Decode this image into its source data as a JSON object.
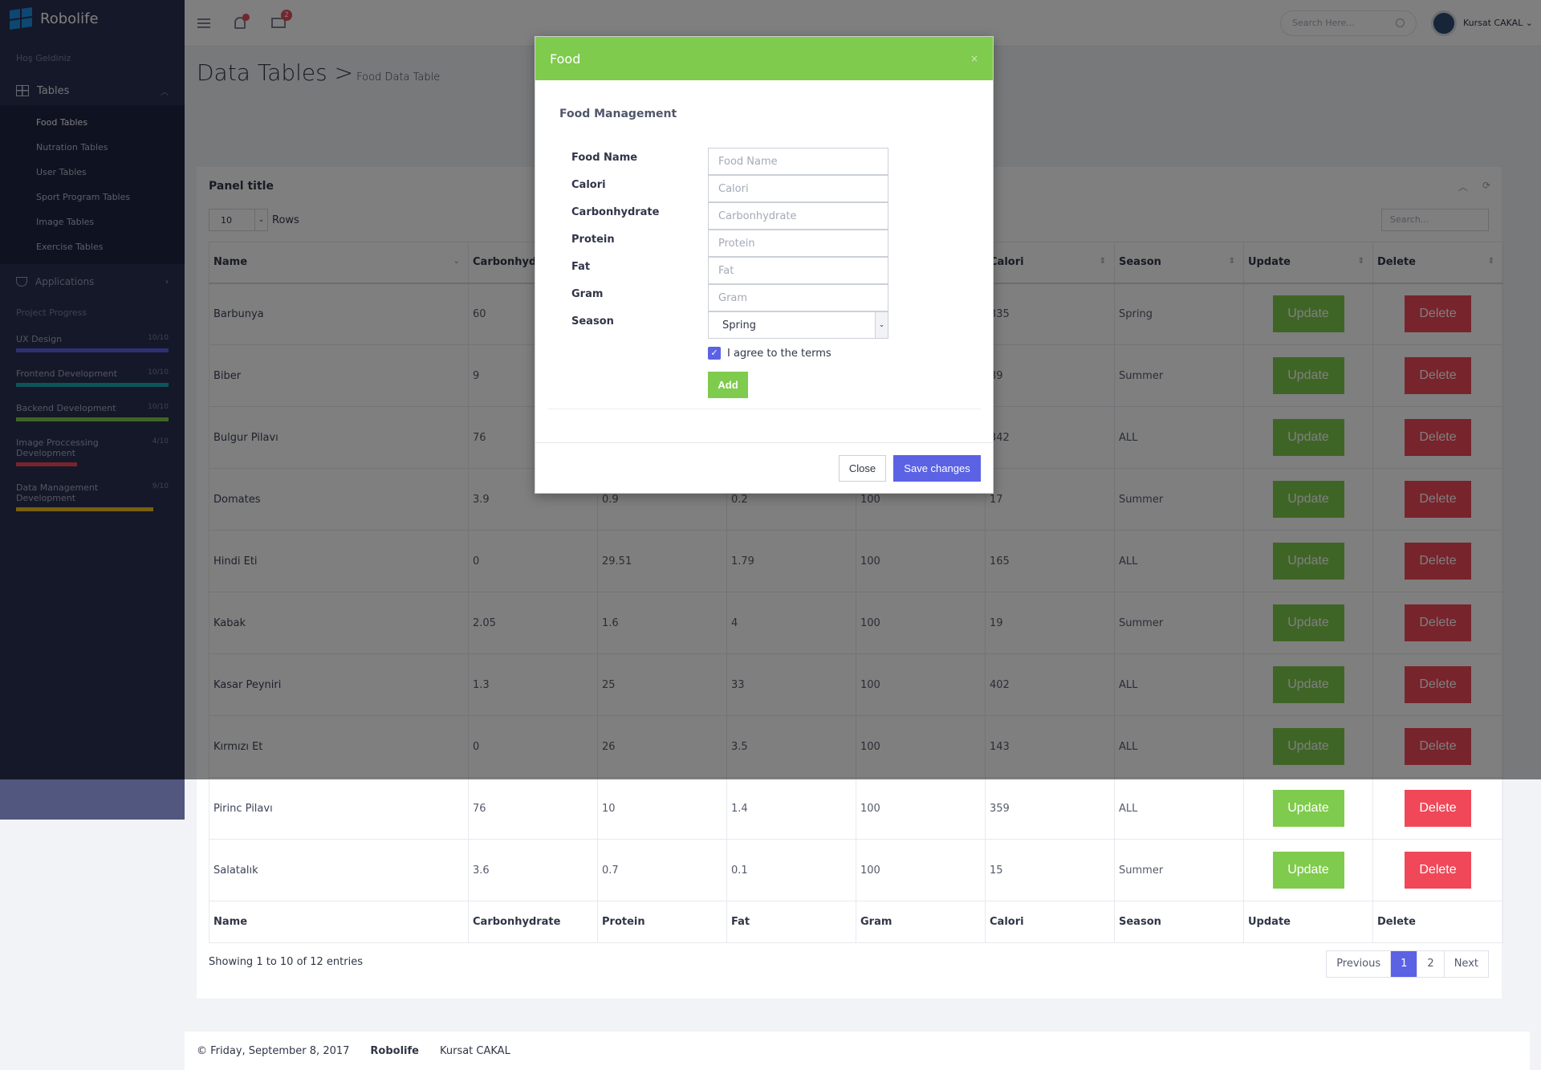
{
  "app": {
    "brand": "Robolife",
    "welcome": "Hoş Geldiniz"
  },
  "sidebar": {
    "tables_label": "Tables",
    "items": [
      {
        "label": "Food Tables"
      },
      {
        "label": "Nutration Tables"
      },
      {
        "label": "User Tables"
      },
      {
        "label": "Sport Program Tables"
      },
      {
        "label": "Image Tables"
      },
      {
        "label": "Exercise Tables"
      }
    ],
    "applications_label": "Applications",
    "progress_title": "Project Progress",
    "progress": [
      {
        "name": "UX Design",
        "value": "10/10",
        "fraction": 1.0,
        "color": "#5b62e4"
      },
      {
        "name": "Frontend Development",
        "value": "10/10",
        "fraction": 1.0,
        "color": "#1aa9b8"
      },
      {
        "name": "Backend Development",
        "value": "10/10",
        "fraction": 1.0,
        "color": "#7fcb4d"
      },
      {
        "name": "Image Proccessing Development",
        "value": "4/10",
        "fraction": 0.4,
        "color": "#f04858"
      },
      {
        "name": "Data Management Development",
        "value": "9/10",
        "fraction": 0.9,
        "color": "#f4c021"
      }
    ]
  },
  "topbar": {
    "mail_badge": "2",
    "search_placeholder": "Search Here...",
    "user_name": "Kursat CAKAL"
  },
  "page": {
    "title": "Data Tables",
    "separator": ">",
    "subtitle": "Food Data Table"
  },
  "panel": {
    "title": "Panel title",
    "length_value": "10",
    "length_suffix": "Rows",
    "search_placeholder": "Search...",
    "columns": [
      "Name",
      "Carbonhydrate",
      "Protein",
      "Fat",
      "Gram",
      "Calori",
      "Season",
      "Update",
      "Delete"
    ],
    "rows": [
      {
        "name": "Barbunya",
        "carb": "60",
        "protein": "",
        "fat": "",
        "gram": "",
        "calori": "335",
        "season": "Spring"
      },
      {
        "name": "Biber",
        "carb": "9",
        "protein": "",
        "fat": "",
        "gram": "",
        "calori": "39",
        "season": "Summer"
      },
      {
        "name": "Bulgur Pilavı",
        "carb": "76",
        "protein": "",
        "fat": "",
        "gram": "",
        "calori": "342",
        "season": "ALL"
      },
      {
        "name": "Domates",
        "carb": "3.9",
        "protein": "0.9",
        "fat": "0.2",
        "gram": "100",
        "calori": "17",
        "season": "Summer"
      },
      {
        "name": "Hindi Eti",
        "carb": "0",
        "protein": "29.51",
        "fat": "1.79",
        "gram": "100",
        "calori": "165",
        "season": "ALL"
      },
      {
        "name": "Kabak",
        "carb": "2.05",
        "protein": "1.6",
        "fat": "4",
        "gram": "100",
        "calori": "19",
        "season": "Summer"
      },
      {
        "name": "Kasar Peyniri",
        "carb": "1.3",
        "protein": "25",
        "fat": "33",
        "gram": "100",
        "calori": "402",
        "season": "ALL"
      },
      {
        "name": "Kırmızı Et",
        "carb": "0",
        "protein": "26",
        "fat": "3.5",
        "gram": "100",
        "calori": "143",
        "season": "ALL"
      },
      {
        "name": "Pirinc Pilavı",
        "carb": "76",
        "protein": "10",
        "fat": "1.4",
        "gram": "100",
        "calori": "359",
        "season": "ALL"
      },
      {
        "name": "Salatalık",
        "carb": "3.6",
        "protein": "0.7",
        "fat": "0.1",
        "gram": "100",
        "calori": "15",
        "season": "Summer"
      }
    ],
    "update_label": "Update",
    "delete_label": "Delete",
    "info": "Showing 1 to 10 of 12 entries",
    "pager": [
      "Previous",
      "1",
      "2",
      "Next"
    ]
  },
  "footer": {
    "date": "© Friday, September 8, 2017",
    "brand": "Robolife",
    "author": "Kursat CAKAL"
  },
  "modal": {
    "title": "Food",
    "close_x": "×",
    "subtitle": "Food Management",
    "fields": [
      {
        "label": "Food Name",
        "placeholder": "Food Name"
      },
      {
        "label": "Calori",
        "placeholder": "Calori"
      },
      {
        "label": "Carbonhydrate",
        "placeholder": "Carbonhydrate"
      },
      {
        "label": "Protein",
        "placeholder": "Protein"
      },
      {
        "label": "Fat",
        "placeholder": "Fat"
      },
      {
        "label": "Gram",
        "placeholder": "Gram"
      }
    ],
    "season_label": "Season",
    "season_value": "Spring",
    "agree_label": "I agree to the terms",
    "add_label": "Add",
    "close_label": "Close",
    "save_label": "Save changes"
  }
}
